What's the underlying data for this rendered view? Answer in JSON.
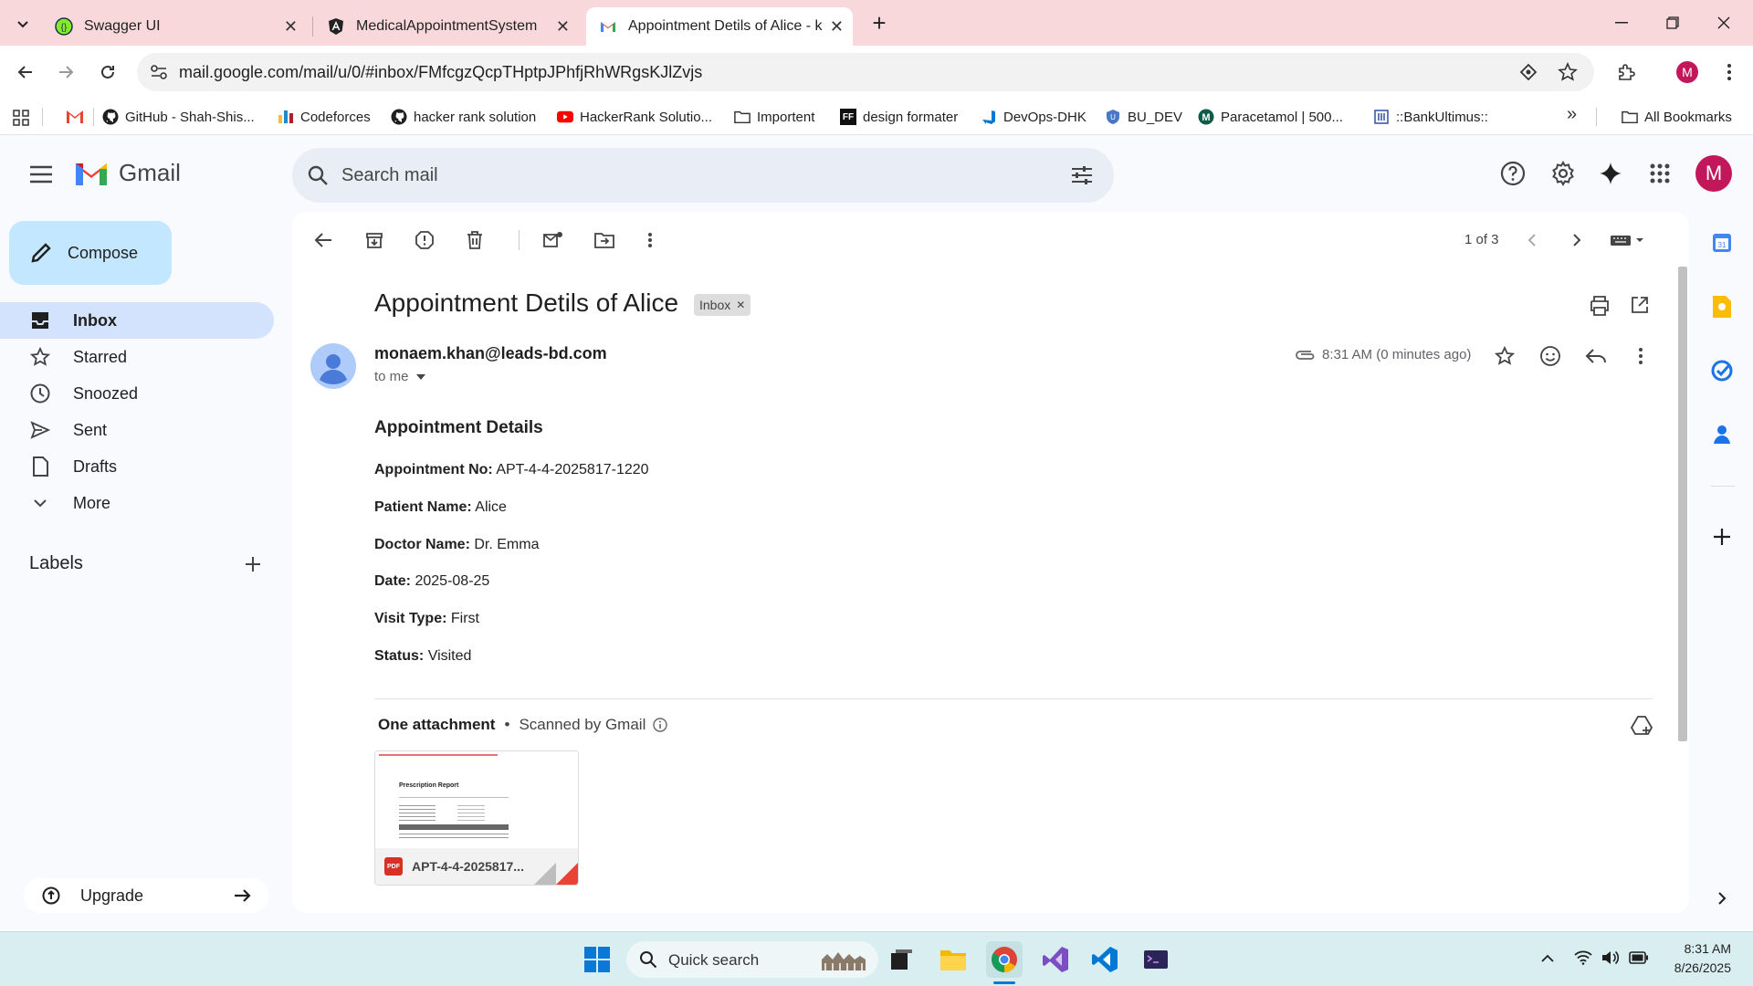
{
  "browser": {
    "tabs": [
      {
        "title": "Swagger UI",
        "icon": "swagger-icon"
      },
      {
        "title": "MedicalAppointmentSystem",
        "icon": "angular-icon"
      },
      {
        "title": "Appointment Detils of Alice - k",
        "icon": "gmail-icon"
      }
    ],
    "url": "mail.google.com/mail/u/0/#inbox/FMfcgzQcpTHptpJPhfjRhWRgsKJlZvjs",
    "profile_initial": "M",
    "bookmarks": [
      {
        "label": "GitHub - Shah-Shis...",
        "icon": "github-icon"
      },
      {
        "label": "Codeforces",
        "icon": "codeforces-icon"
      },
      {
        "label": "hacker rank solution",
        "icon": "github-icon"
      },
      {
        "label": "HackerRank Solutio...",
        "icon": "youtube-icon"
      },
      {
        "label": "Importent",
        "icon": "folder-icon"
      },
      {
        "label": "design formater",
        "icon": "ff-icon"
      },
      {
        "label": "DevOps-DHK",
        "icon": "azure-devops-icon"
      },
      {
        "label": "BU_DEV",
        "icon": "bu-icon"
      },
      {
        "label": "Paracetamol | 500...",
        "icon": "medex-icon"
      },
      {
        "label": "::BankUltimus::",
        "icon": "bank-icon"
      }
    ],
    "all_bookmarks": "All Bookmarks"
  },
  "gmail": {
    "logo": "Gmail",
    "search_placeholder": "Search mail",
    "compose": "Compose",
    "nav": [
      {
        "label": "Inbox",
        "icon": "inbox-icon"
      },
      {
        "label": "Starred",
        "icon": "star-icon"
      },
      {
        "label": "Snoozed",
        "icon": "clock-icon"
      },
      {
        "label": "Sent",
        "icon": "send-icon"
      },
      {
        "label": "Drafts",
        "icon": "draft-icon"
      },
      {
        "label": "More",
        "icon": "chevron-down-icon"
      }
    ],
    "labels_heading": "Labels",
    "upgrade": "Upgrade",
    "avatar_initial": "M"
  },
  "message": {
    "pager": "1 of 3",
    "subject": "Appointment Detils of Alice",
    "label_chip": "Inbox",
    "from": "monaem.khan@leads-bd.com",
    "to": "to me",
    "time": "8:31 AM (0 minutes ago)",
    "heading": "Appointment Details",
    "fields": [
      {
        "key": "Appointment No:",
        "value": "APT-4-4-2025817-1220"
      },
      {
        "key": "Patient Name:",
        "value": "Alice"
      },
      {
        "key": "Doctor Name:",
        "value": "Dr. Emma"
      },
      {
        "key": "Date:",
        "value": "2025-08-25"
      },
      {
        "key": "Visit Type:",
        "value": "First"
      },
      {
        "key": "Status:",
        "value": "Visited"
      }
    ],
    "attachments_title": "One attachment",
    "attachments_scanned": "Scanned by Gmail",
    "attachment": {
      "name": "APT-4-4-2025817...",
      "preview_title": "Prescription Report",
      "pdf_badge": "PDF"
    }
  },
  "taskbar": {
    "search": "Quick search",
    "time": "8:31 AM",
    "date": "8/26/2025"
  }
}
